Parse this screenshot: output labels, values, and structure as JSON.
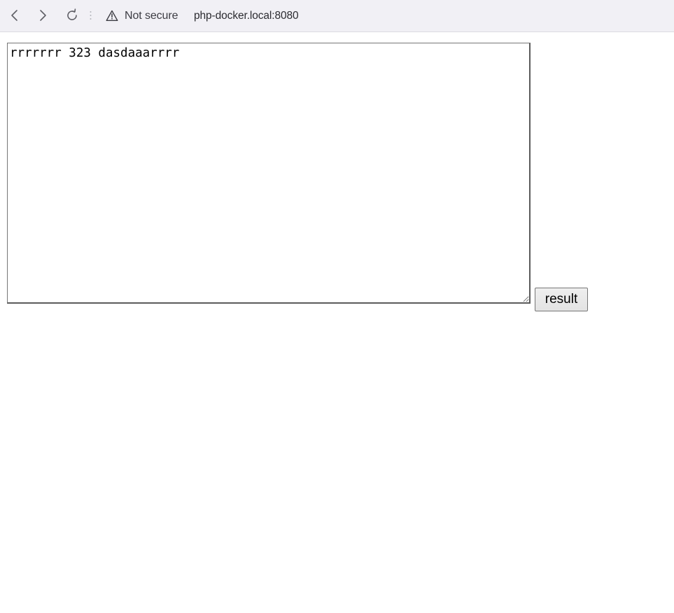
{
  "browser": {
    "back_icon": "chevron-left-icon",
    "forward_icon": "chevron-right-icon",
    "reload_icon": "reload-icon",
    "security_icon": "warning-triangle-icon",
    "security_label": "Not secure",
    "url": "php-docker.local:8080"
  },
  "form": {
    "textarea_value": "rrrrrrr 323 dasdaaarrrr",
    "submit_label": "result"
  },
  "colors": {
    "toolbar_bg": "#f1f0f5",
    "page_bg": "#ffffff"
  }
}
